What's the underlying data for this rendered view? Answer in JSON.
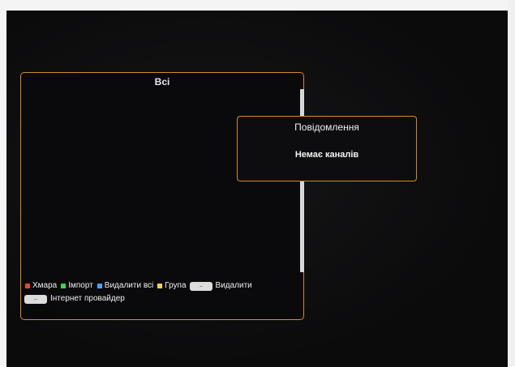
{
  "channel_list": {
    "title": "Всі",
    "legend": [
      {
        "color": "#e8452b",
        "label": "Хмара",
        "icon": "red-square-icon"
      },
      {
        "color": "#3fd44a",
        "label": "Імпорт",
        "icon": "green-square-icon"
      },
      {
        "color": "#3fa6ff",
        "label": "Видалити всі",
        "icon": "blue-square-icon"
      },
      {
        "color": "#f2d54a",
        "label": "Група",
        "icon": "yellow-square-icon"
      }
    ],
    "delete_label": "Видалити",
    "provider_label": "Інтернет провайдер"
  },
  "dialog": {
    "title": "Повідомлення",
    "message": "Немає каналів"
  }
}
